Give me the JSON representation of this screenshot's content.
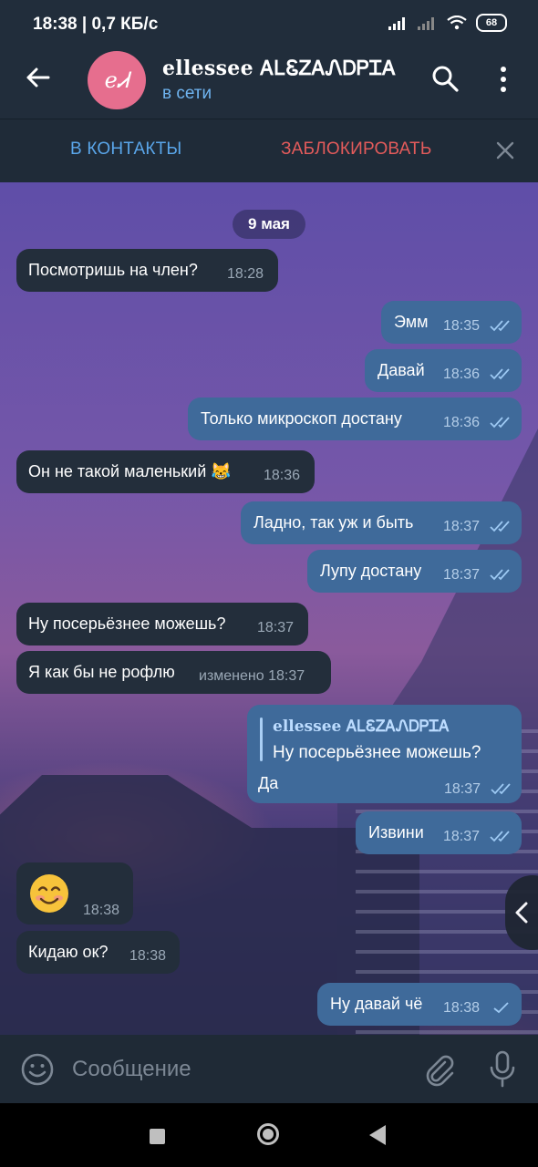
{
  "status_bar": {
    "time_speed": "18:38 | 0,7 КБ/с",
    "battery": "68"
  },
  "header": {
    "avatar_initials": "eᏗ",
    "contact_name": "ellessee ᎪᏞᏋᏃᎪᏁᎠᏢᏆᎪ",
    "status": "в сети"
  },
  "action_bar": {
    "add_contact": "В КОНТАКТЫ",
    "block": "ЗАБЛОКИРОВАТЬ"
  },
  "chat": {
    "date": "9 мая",
    "messages": [
      {
        "dir": "in",
        "text": "Посмотришь на член?",
        "time": "18:28"
      },
      {
        "dir": "out",
        "text": "Эмм",
        "time": "18:35"
      },
      {
        "dir": "out",
        "text": "Давай",
        "time": "18:36"
      },
      {
        "dir": "out",
        "text": "Только микроскоп достану",
        "time": "18:36"
      },
      {
        "dir": "in",
        "text": "Он не такой маленький 😹",
        "time": "18:36"
      },
      {
        "dir": "out",
        "text": "Ладно, так уж и быть",
        "time": "18:37"
      },
      {
        "dir": "out",
        "text": "Лупу достану",
        "time": "18:37"
      },
      {
        "dir": "in",
        "text": "Ну посерьёзнее можешь?",
        "time": "18:37"
      },
      {
        "dir": "in",
        "text": "Я как бы не рофлю",
        "time": "изменено 18:37"
      },
      {
        "dir": "out",
        "reply_name": "ellessee ᎪᏞᏋᏃᎪᏁᎠᏢᏆᎪ",
        "reply_text": "Ну посерьёзнее можешь?",
        "text": "Да",
        "time": "18:37"
      },
      {
        "dir": "out",
        "text": "Извини",
        "time": "18:37"
      },
      {
        "dir": "in",
        "emoji": "smiling-face",
        "time": "18:38"
      },
      {
        "dir": "in",
        "text": "Кидаю ок?",
        "time": "18:38"
      },
      {
        "dir": "out",
        "text": "Ну давай чё",
        "time": "18:38"
      }
    ]
  },
  "composer": {
    "placeholder": "Сообщение"
  },
  "colors": {
    "incoming_bubble": "#232e3b",
    "outgoing_bubble": "#3f6a9a",
    "accent": "#5aa6ea",
    "danger": "#e45b5b"
  }
}
